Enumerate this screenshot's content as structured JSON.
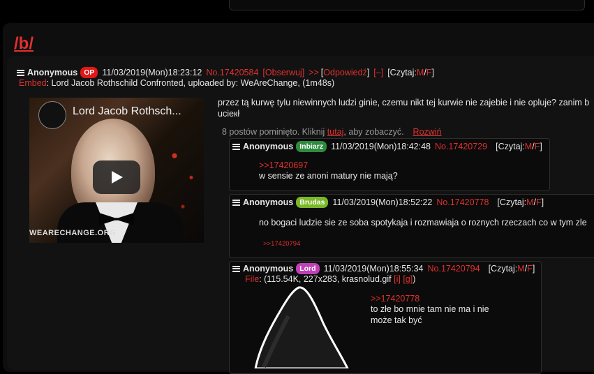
{
  "board": {
    "title": "/b/"
  },
  "thread": {
    "op": {
      "name": "Anonymous",
      "badge": "OP",
      "datetime": "11/03/2019(Mon)18:23:12",
      "post_no": "No.17420584",
      "watch": "[Obserwuj]",
      "arrows": ">>",
      "reply_link": "Odpowiedź",
      "collapse": "[–]",
      "read_label": "[Czytaj: ",
      "read_m": "M",
      "read_slash": "/",
      "read_f": "F",
      "read_close": "]",
      "embed_label": "Embed",
      "embed_text": ": Lord Jacob Rothschild Confronted, uploaded by: WeAreChange, (1m48s)",
      "video_title": "Lord Jacob Rothsch...",
      "video_watermark": "WEARECHANGE.ORG",
      "text": "przez tą kurwę tylu niewinnych ludzi ginie, czemu nikt tej kurwie nie zajebie i nie opluje? zanim b ucieкł"
    },
    "omitted": {
      "prefix": "8 postów pominięto. Kliknij ",
      "link": "tutaj",
      "suffix": ", aby zobaczyć.",
      "expand": "Rozwiń"
    },
    "replies": [
      {
        "name": "Anonymous",
        "badge": "Inbiarz",
        "badge_color": "#2e8b3e",
        "datetime": "11/03/2019(Mon)18:42:48",
        "post_no": "No.17420729",
        "read_label": "[Czytaj: ",
        "quote": ">>17420697",
        "text": "w sensie ze anoni matury nie mają?"
      },
      {
        "name": "Anonymous",
        "badge": "Brudas",
        "badge_color": "#7ab828",
        "datetime": "11/03/2019(Mon)18:52:22",
        "post_no": "No.17420778",
        "read_label": "[Czytaj: ",
        "text": "no bogaci ludzie sie ze soba spotykaja i rozmawiaja o roznych rzeczach co w tym zle",
        "backlink": ">>17420794"
      },
      {
        "name": "Anonymous",
        "badge": "Lord",
        "badge_color": "#c040b8",
        "datetime": "11/03/2019(Mon)18:55:34",
        "post_no": "No.17420794",
        "read_label": "[Czytaj: ",
        "file_label": "File",
        "file_text": ": (115.54K, 227x283, krasnolud.gif ",
        "file_i": "[i]",
        "file_g": "[g]",
        "file_close": ")",
        "quote": ">>17420778",
        "text_line1": "to złe bo mnie tam nie ma i nie",
        "text_line2": "może tak być"
      }
    ]
  },
  "colors": {
    "accent": "#e03030",
    "op_badge": "#e01818",
    "background": "#000000"
  }
}
